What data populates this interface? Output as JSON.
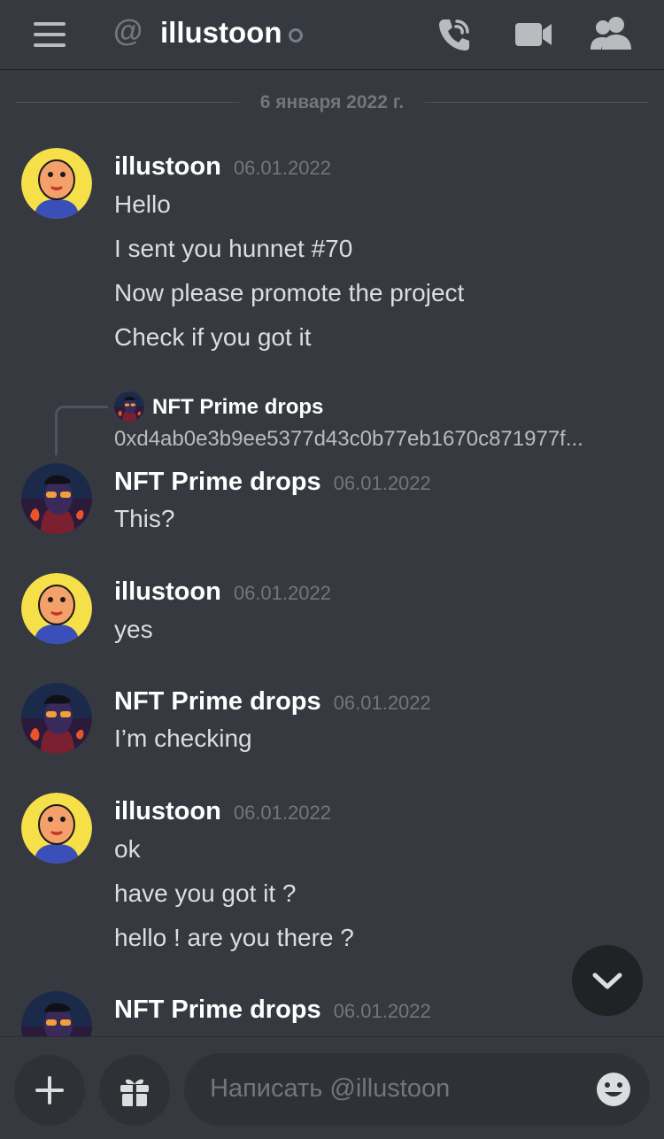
{
  "header": {
    "at_symbol": "@",
    "title": "illustoon"
  },
  "divider": {
    "date": "6 января 2022 г."
  },
  "reply": {
    "author": "NFT Prime drops",
    "text": "0xd4ab0e3b9ee5377d43c0b77eb1670c871977f..."
  },
  "messages": [
    {
      "author": "illustoon",
      "time": "06.01.2022",
      "lines": [
        "Hello",
        "I sent you hunnet #70",
        "Now please promote the project",
        "Check if you got it"
      ]
    },
    {
      "author": "NFT Prime drops",
      "time": "06.01.2022",
      "lines": [
        "This?"
      ]
    },
    {
      "author": "illustoon",
      "time": "06.01.2022",
      "lines": [
        "yes"
      ]
    },
    {
      "author": "NFT Prime drops",
      "time": "06.01.2022",
      "lines": [
        "I’m checking"
      ]
    },
    {
      "author": "illustoon",
      "time": "06.01.2022",
      "lines": [
        "ok",
        "have you got it ?",
        "hello ! are you there ?"
      ]
    },
    {
      "author": "NFT Prime drops",
      "time": "06.01.2022",
      "lines": []
    }
  ],
  "composer": {
    "placeholder": "Написать @illustoon"
  },
  "icons": {
    "menu": "hamburger-icon",
    "call": "phone-call-icon",
    "video": "video-camera-icon",
    "members": "members-icon",
    "add": "plus-icon",
    "gift": "gift-icon",
    "emoji": "emoji-icon",
    "scroll": "chevron-down-icon"
  },
  "colors": {
    "background": "#36393f",
    "text": "#dcddde",
    "muted": "#72767d",
    "dark": "#2f3136"
  }
}
